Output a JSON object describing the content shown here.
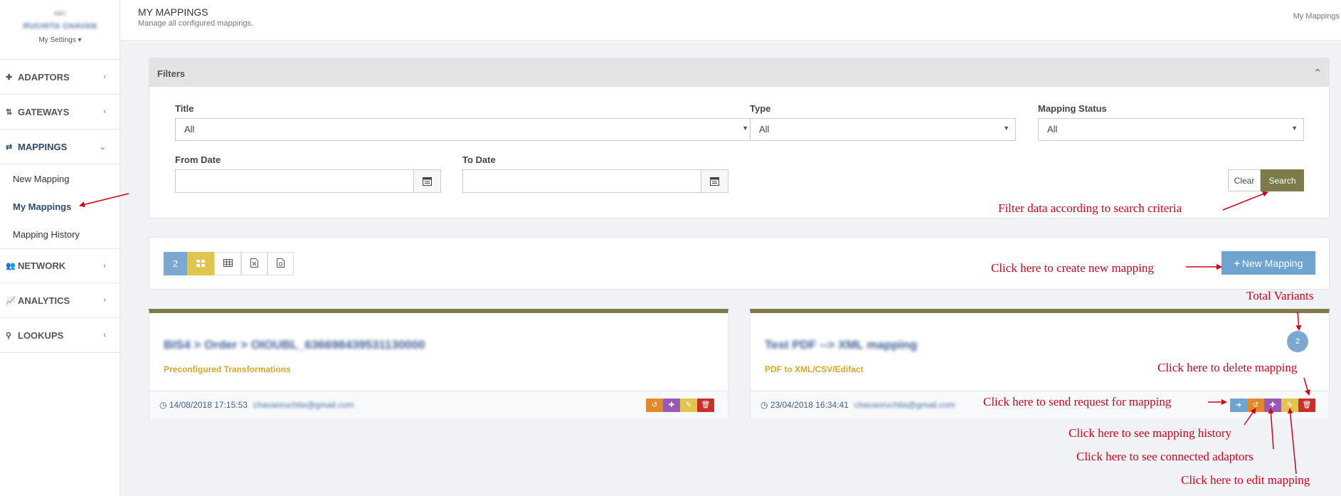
{
  "sidebar": {
    "org": "ABC",
    "user_name": "RUCHITA CHAVAN",
    "settings_label": "My Settings",
    "items": [
      {
        "icon": "puzzle-icon",
        "label": "ADAPTORS"
      },
      {
        "icon": "signpost-icon",
        "label": "GATEWAYS"
      },
      {
        "icon": "exchange-icon",
        "label": "MAPPINGS",
        "active": true
      },
      {
        "icon": "users-icon",
        "label": "NETWORK"
      },
      {
        "icon": "chart-line-icon",
        "label": "ANALYTICS"
      },
      {
        "icon": "binoculars-icon",
        "label": "LOOKUPS"
      }
    ],
    "sub_items": [
      {
        "label": "New Mapping"
      },
      {
        "label": "My Mappings",
        "active": true
      },
      {
        "label": "Mapping History"
      }
    ]
  },
  "header": {
    "title": "MY MAPPINGS",
    "subtitle": "Manage all configured mappings.",
    "breadcrumb": "My Mappings"
  },
  "filters": {
    "heading": "Filters",
    "title_label": "Title",
    "title_value": "All",
    "type_label": "Type",
    "type_value": "All",
    "status_label": "Mapping Status",
    "status_value": "All",
    "from_label": "From Date",
    "to_label": "To Date",
    "clear_label": "Clear",
    "search_label": "Search"
  },
  "toolbar": {
    "count": "2",
    "new_mapping_label": "New Mapping"
  },
  "cards": [
    {
      "title": "BIS4 > Order > OIOUBL_636698439531130000",
      "subtitle": "Preconfigured Transformations",
      "date": "14/08/2018 17:15:53",
      "email": "chavanruchita@gmail.com"
    },
    {
      "title": "Test PDF --> XML mapping",
      "subtitle": "PDF to XML/CSV/Edifact",
      "date": "23/04/2018 16:34:41",
      "email": "chavanruchita@gmail.com",
      "variants": "2"
    }
  ],
  "annotations": {
    "filter": "Filter data according to search criteria",
    "create": "Click here to create new mapping",
    "variants": "Total Variants",
    "delete": "Click here to delete mapping",
    "send": "Click here to send request for mapping",
    "history": "Click here to see mapping history",
    "adaptors": "Click here to see connected adaptors",
    "edit": "Click here to edit mapping"
  },
  "colors": {
    "accent_olive": "#7d7a4c",
    "blue": "#6fa3d0",
    "yellow": "#e0c64f",
    "orange": "#e08a2b",
    "purple": "#9b59b6",
    "red": "#c9302c",
    "annotation_red": "#d0021b"
  }
}
